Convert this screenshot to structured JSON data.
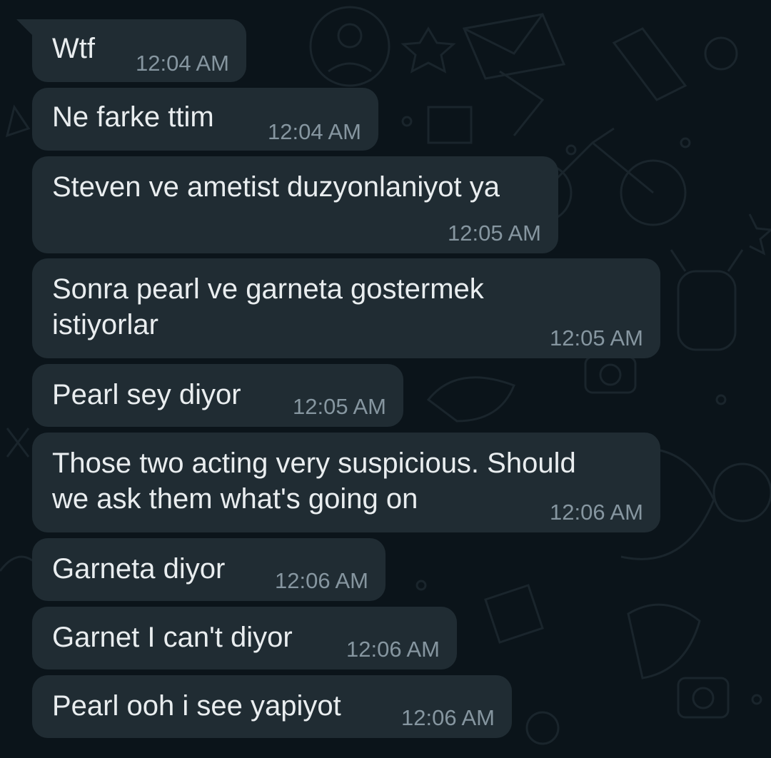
{
  "chat": {
    "messages": [
      {
        "text": "Wtf",
        "time": "12:04 AM"
      },
      {
        "text": "Ne farke ttim",
        "time": "12:04 AM"
      },
      {
        "text": "Steven ve ametist duzyonlaniyot ya",
        "time": "12:05 AM"
      },
      {
        "text_line1": "Sonra pearl ve garneta gostermek",
        "text_line2": "istiyorlar",
        "time": "12:05 AM"
      },
      {
        "text": "Pearl sey diyor",
        "time": "12:05 AM"
      },
      {
        "text_line1": "Those two acting very suspicious. Should",
        "text_line2": "we ask them what's going on",
        "time": "12:06 AM"
      },
      {
        "text": "Garneta diyor",
        "time": "12:06 AM"
      },
      {
        "text": "Garnet I can't diyor",
        "time": "12:06 AM"
      },
      {
        "text": "Pearl ooh i see yapiyot",
        "time": "12:06 AM"
      }
    ]
  },
  "colors": {
    "background": "#0b141a",
    "bubble": "#202c33",
    "text": "#e9edef",
    "timestamp": "#8696a0"
  }
}
